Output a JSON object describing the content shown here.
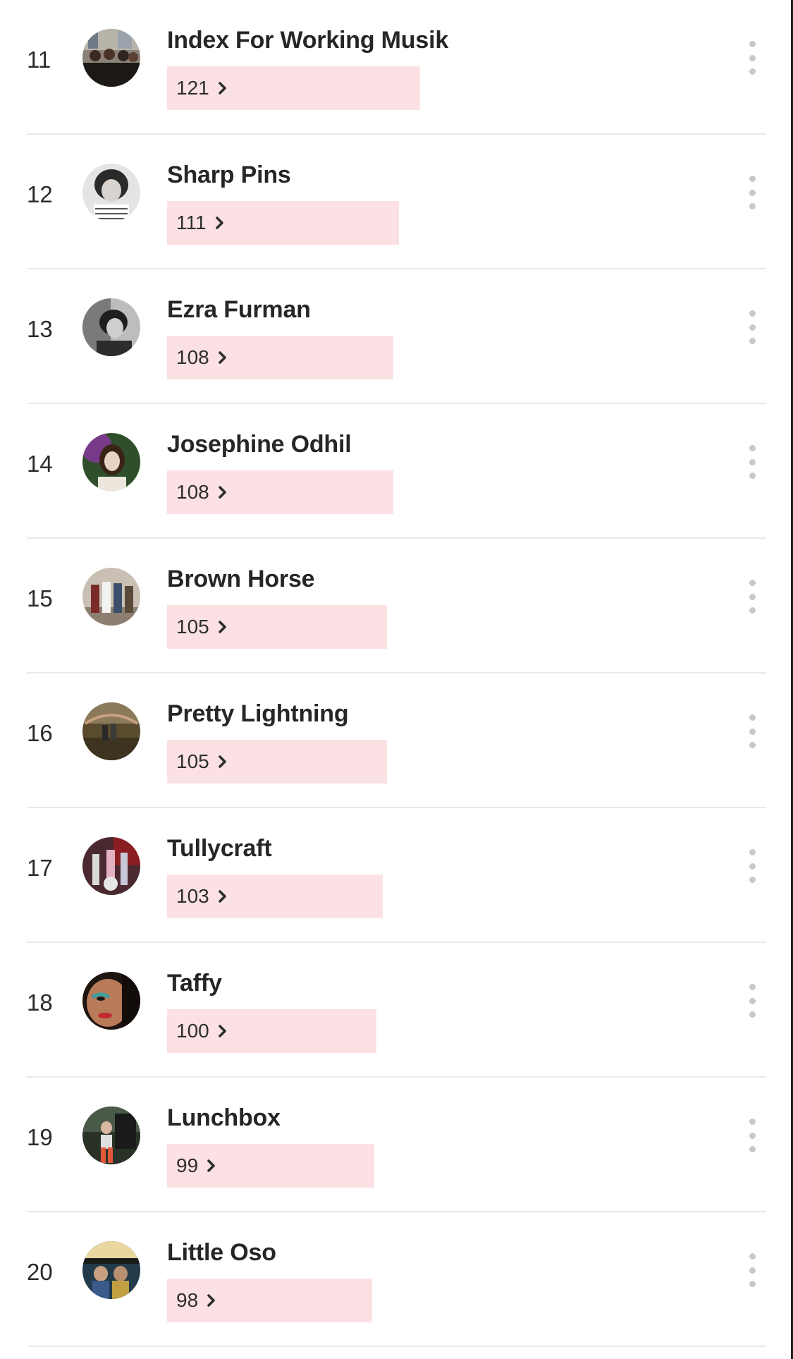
{
  "list": {
    "items": [
      {
        "rank": "11",
        "name": "Index For Working Musik",
        "count": "121",
        "fraction": 1.0
      },
      {
        "rank": "12",
        "name": "Sharp Pins",
        "count": "111",
        "fraction": 0.917
      },
      {
        "rank": "13",
        "name": "Ezra Furman",
        "count": "108",
        "fraction": 0.893
      },
      {
        "rank": "14",
        "name": "Josephine Odhil",
        "count": "108",
        "fraction": 0.893
      },
      {
        "rank": "15",
        "name": "Brown Horse",
        "count": "105",
        "fraction": 0.868
      },
      {
        "rank": "16",
        "name": "Pretty Lightning",
        "count": "105",
        "fraction": 0.868
      },
      {
        "rank": "17",
        "name": "Tullycraft",
        "count": "103",
        "fraction": 0.851
      },
      {
        "rank": "18",
        "name": "Taffy",
        "count": "100",
        "fraction": 0.826
      },
      {
        "rank": "19",
        "name": "Lunchbox",
        "count": "99",
        "fraction": 0.818
      },
      {
        "rank": "20",
        "name": "Little Oso",
        "count": "98",
        "fraction": 0.81
      }
    ]
  },
  "colors": {
    "bar": "#fce1e4",
    "divider": "#e9e9e9",
    "menu_dots": "#c8c8c8"
  },
  "icons": {
    "chevron": "chevron-right-icon",
    "menu": "more-vertical-icon"
  }
}
